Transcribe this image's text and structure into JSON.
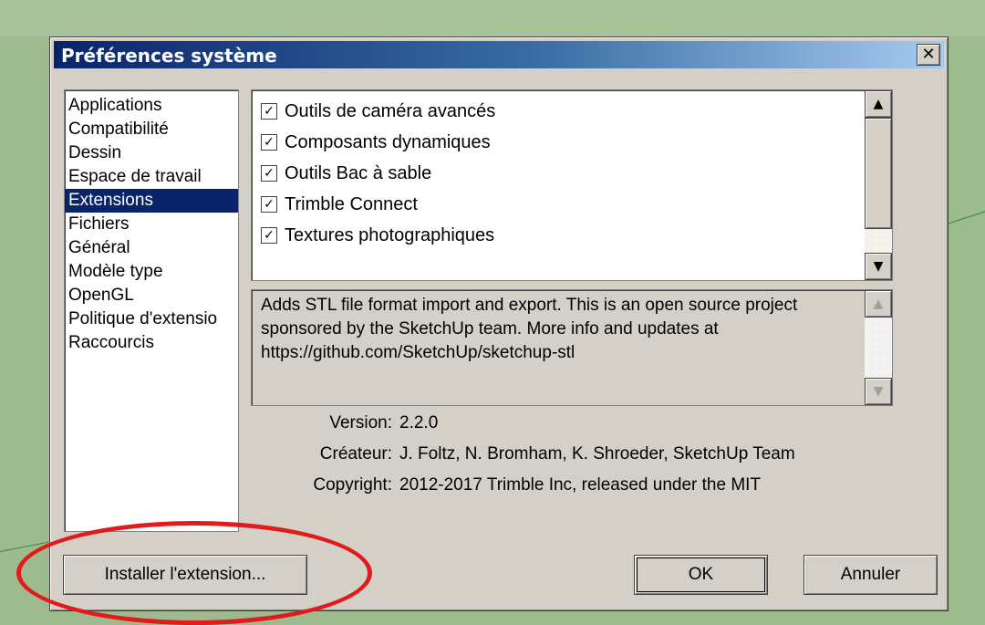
{
  "dialog": {
    "title": "Préférences système",
    "close_glyph": "✕"
  },
  "sidebar": {
    "items": [
      {
        "label": "Applications",
        "selected": false
      },
      {
        "label": "Compatibilité",
        "selected": false
      },
      {
        "label": "Dessin",
        "selected": false
      },
      {
        "label": "Espace de travail",
        "selected": false
      },
      {
        "label": "Extensions",
        "selected": true
      },
      {
        "label": "Fichiers",
        "selected": false
      },
      {
        "label": "Général",
        "selected": false
      },
      {
        "label": "Modèle type",
        "selected": false
      },
      {
        "label": "OpenGL",
        "selected": false
      },
      {
        "label": "Politique d'extensio",
        "selected": false
      },
      {
        "label": "Raccourcis",
        "selected": false
      }
    ]
  },
  "extensions": [
    {
      "label": "Outils de caméra avancés",
      "checked": true
    },
    {
      "label": "Composants dynamiques",
      "checked": true
    },
    {
      "label": "Outils Bac à sable",
      "checked": true
    },
    {
      "label": "Trimble Connect",
      "checked": true
    },
    {
      "label": "Textures photographiques",
      "checked": true
    }
  ],
  "description": "Adds STL file format import and export. This is an open source project sponsored by the SketchUp team. More info and updates at https://github.com/SketchUp/sketchup-stl",
  "details": {
    "version_label": "Version:",
    "version_value": "2.2.0",
    "creator_label": "Créateur:",
    "creator_value": "J. Foltz, N. Bromham, K. Shroeder, SketchUp Team",
    "copyright_label": "Copyright:",
    "copyright_value": "2012-2017 Trimble Inc, released under the MIT"
  },
  "buttons": {
    "install": "Installer l'extension...",
    "ok": "OK",
    "cancel": "Annuler"
  },
  "annotation": {
    "highlight_color": "#e11a1a"
  },
  "icons": {
    "checkbox_check": "✓",
    "scroll_up": "▲",
    "scroll_down": "▼"
  }
}
